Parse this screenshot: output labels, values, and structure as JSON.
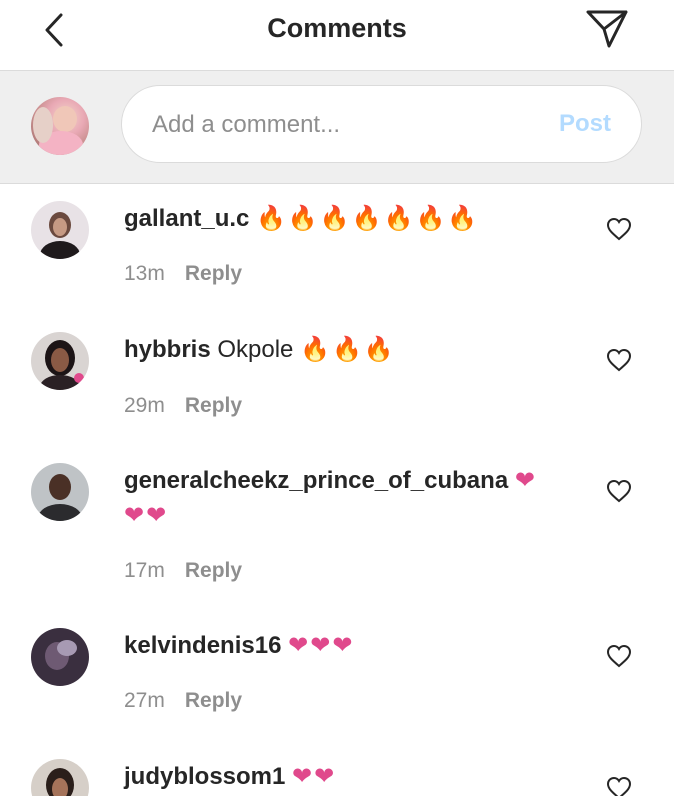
{
  "header": {
    "title": "Comments",
    "back_icon": "chevron-left-icon",
    "send_icon": "paper-plane-icon"
  },
  "composer": {
    "placeholder": "Add a comment...",
    "post_label": "Post"
  },
  "colors": {
    "post_disabled": "#b3dbff",
    "fire": "#f27a12",
    "heart": "#e0498c",
    "meta_gray": "#8e8e8e"
  },
  "comments": [
    {
      "username": "gallant_u.c",
      "text": "",
      "emoji": "🔥🔥🔥🔥🔥🔥🔥",
      "emoji_type": "fire",
      "time": "13m",
      "reply_label": "Reply"
    },
    {
      "username": "hybbris",
      "text": "Okpole",
      "emoji": "🔥🔥🔥",
      "emoji_type": "fire",
      "time": "29m",
      "reply_label": "Reply"
    },
    {
      "username": "generalcheekz_prince_of_cubana",
      "text": "",
      "emoji": "❤",
      "emoji_line2": "❤❤",
      "emoji_type": "heart",
      "time": "17m",
      "reply_label": "Reply"
    },
    {
      "username": "kelvindenis16",
      "text": "",
      "emoji": "❤❤❤",
      "emoji_type": "heart",
      "time": "27m",
      "reply_label": "Reply"
    },
    {
      "username": "judyblossom1",
      "text": "",
      "emoji": "❤❤",
      "emoji_type": "heart"
    }
  ]
}
